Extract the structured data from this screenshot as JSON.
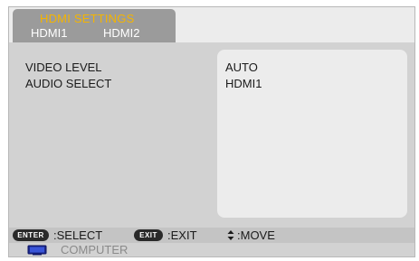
{
  "header": {
    "title": "HDMI SETTINGS",
    "tabs": [
      {
        "label": "HDMI1"
      },
      {
        "label": "HDMI2"
      }
    ]
  },
  "settings": [
    {
      "label": "VIDEO LEVEL",
      "value": "AUTO"
    },
    {
      "label": "AUDIO SELECT",
      "value": "HDMI1"
    }
  ],
  "hints": {
    "enter_key": "ENTER",
    "enter_text": ":SELECT",
    "exit_key": "EXIT",
    "exit_text": ":EXIT",
    "move_text": ":MOVE"
  },
  "source": {
    "label": "COMPUTER",
    "icon": "monitor-icon"
  },
  "colors": {
    "title_accent": "#f4b400",
    "panel_bg": "#d2d2d2",
    "tab_bg": "#9b9b9b"
  }
}
